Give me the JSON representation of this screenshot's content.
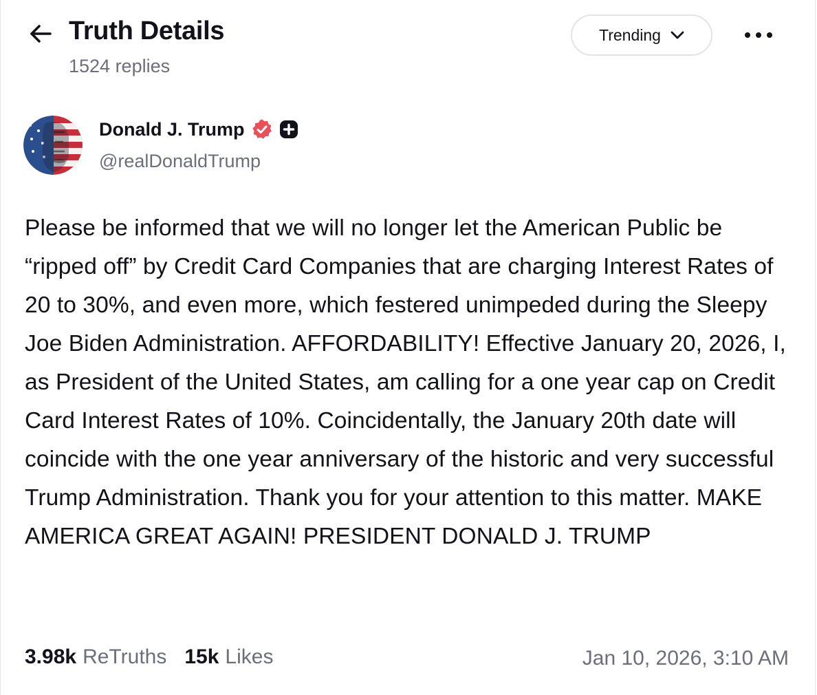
{
  "header": {
    "title": "Truth Details",
    "replies": "1524 replies",
    "sort": {
      "selected": "Trending"
    },
    "icons": {
      "back": "arrow-left-icon",
      "sort": "chevron-down-icon",
      "more": "more-horizontal-icon"
    }
  },
  "post": {
    "author": {
      "name": "Donald J. Trump",
      "handle": "@realDonaldTrump",
      "avatar": "avatar-flag-portrait",
      "badges": [
        "verified-badge-icon",
        "plus-badge-icon"
      ]
    },
    "body": "Please be informed that we will no longer let the American Public be “ripped off” by Credit Card Companies that are charging Interest Rates of 20 to 30%, and even more, which festered unimpeded during the Sleepy Joe Biden Administration. AFFORDABILITY! Effective January 20, 2026, I, as President of the United States, am calling for a one year cap on Credit Card Interest Rates of 10%. Coincidentally, the January 20th date will coincide with the one year anniversary of the historic and very successful Trump Administration. Thank you for your attention to this matter. MAKE AMERICA GREAT AGAIN! PRESIDENT DONALD J. TRUMP",
    "stats": {
      "retruths_count": "3.98k",
      "retruths_label": "ReTruths",
      "likes_count": "15k",
      "likes_label": "Likes"
    },
    "timestamp": "Jan 10, 2026, 3:10 AM"
  },
  "colors": {
    "text": "#11121a",
    "muted": "#6b6e7b",
    "verified_badge": "#e8505b",
    "border": "#e3e4e8"
  }
}
